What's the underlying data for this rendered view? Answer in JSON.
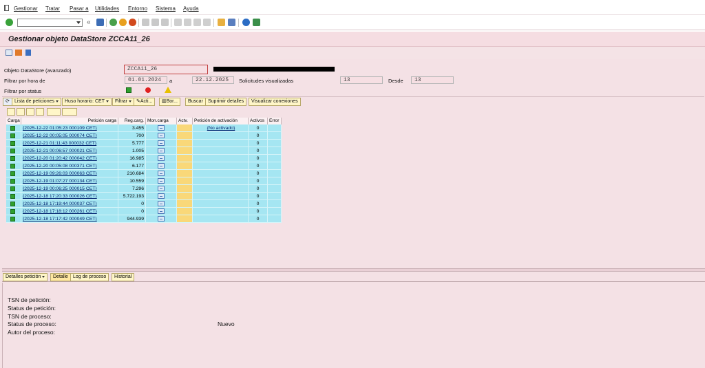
{
  "menu": {
    "items": [
      "Gestionar",
      "Tratar",
      "Pasar a",
      "Utilidades",
      "Entorno",
      "Sistema",
      "Ayuda"
    ]
  },
  "toolbar": {
    "command_field": "",
    "icons": [
      "enter-icon",
      "save-icon",
      "back-icon",
      "exit-icon",
      "cancel-icon",
      "print-icon",
      "find-icon",
      "find-next-icon",
      "first-page-icon",
      "prev-page-icon",
      "next-page-icon",
      "last-page-icon",
      "new-session-icon",
      "shortcut-icon",
      "help-icon",
      "customize-icon"
    ]
  },
  "title": "Gestionar objeto DataStore ZCCA11_26",
  "app_toolbar": {
    "icons": [
      "layout-icon",
      "hierarchy-icon",
      "info-icon"
    ]
  },
  "filters": {
    "datastore_label": "Objeto DataStore (avanzado)",
    "datastore_value": "ZCCA11_26",
    "date_label": "Filtrar por hora de",
    "date_from": "01.01.2024",
    "date_to_label": "a",
    "date_to": "22.12.2025",
    "requests_label": "Solicitudes visualizadas",
    "requests_value": "13",
    "from_label": "Desde",
    "from_value": "13",
    "status_label": "Filtrar por status",
    "status_icons": [
      "green-status-icon",
      "red-status-icon",
      "yellow-warning-icon"
    ]
  },
  "buttons": {
    "requests_list": "Lista de peticiones",
    "timezone": "Huso horario: CET",
    "filter": "Filtrar",
    "activate": "Acti...",
    "delete": "Bor...",
    "search": "Buscar",
    "suppress_details": "Suprimir detalles",
    "show_connections": "Visualizar conexiones"
  },
  "grid": {
    "headers": {
      "carga": "Carga",
      "peticion_carga": "Petición carga",
      "reg_carg": "Reg.carg.",
      "mon_carga": "Mon.carga",
      "actv": "Actv.",
      "peticion_activacion": "Petición de activación",
      "activos": "Activos",
      "error": "Error"
    },
    "rows": [
      {
        "request": "{2025-12-22 01:05:23 000109 CET}",
        "records": "3.455",
        "activation": "{No activado}",
        "active": "0",
        "error": ""
      },
      {
        "request": "{2025-12-22 00:05:05 000074 CET}",
        "records": "700",
        "activation": "",
        "active": "0",
        "error": ""
      },
      {
        "request": "{2025-12-21 01:11:43 000032 CET}",
        "records": "5.777",
        "activation": "",
        "active": "0",
        "error": ""
      },
      {
        "request": "{2025-12-21 00:06:57 000021 CET}",
        "records": "1.005",
        "activation": "",
        "active": "0",
        "error": ""
      },
      {
        "request": "{2025-12-20 01:20:42 000042 CET}",
        "records": "16.985",
        "activation": "",
        "active": "0",
        "error": ""
      },
      {
        "request": "{2025-12-20 00:05:08 000371 CET}",
        "records": "6.177",
        "activation": "",
        "active": "0",
        "error": ""
      },
      {
        "request": "{2025-12-19 09:26:03 000063 CET}",
        "records": "210.684",
        "activation": "",
        "active": "0",
        "error": ""
      },
      {
        "request": "{2025-12-19 01:07:27 000134 CET}",
        "records": "10.559",
        "activation": "",
        "active": "0",
        "error": ""
      },
      {
        "request": "{2025-12-19 00:06:25 000015 CET}",
        "records": "7.296",
        "activation": "",
        "active": "0",
        "error": ""
      },
      {
        "request": "{2025-12-18 17:20:33 000026 CET}",
        "records": "5.722.193",
        "activation": "",
        "active": "0",
        "error": ""
      },
      {
        "request": "{2025-12-18 17:19:44 000037 CET}",
        "records": "0",
        "activation": "",
        "active": "0",
        "error": ""
      },
      {
        "request": "{2025-12-18 17:18:12 000261 CET}",
        "records": "0",
        "activation": "",
        "active": "0",
        "error": ""
      },
      {
        "request": "{2025-12-18 17:17:42 000049 CET}",
        "records": "944.939",
        "activation": "",
        "active": "0",
        "error": ""
      }
    ]
  },
  "tabs": {
    "request_details": "Detalles petición",
    "detail": "Detalle",
    "process_log": "Log de proceso",
    "history": "Historial"
  },
  "detail": {
    "tsn_request_label": "TSN de petición:",
    "status_request_label": "Status de petición:",
    "tsn_process_label": "TSN de proceso:",
    "status_process_label": "Status de proceso:",
    "status_process_value": "Nuevo",
    "author_label": "Autor del proceso:"
  },
  "colors": {
    "background": "#f4e1e5",
    "title_bar": "#f5dde2",
    "grid_row": "#a5e6f2",
    "actv_column": "#f9d879",
    "button": "#fff6c8",
    "status_green": "#2ea02e"
  }
}
